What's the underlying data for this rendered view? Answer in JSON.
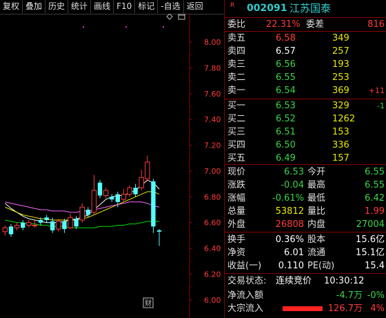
{
  "toolbar": [
    "复权",
    "叠加",
    "历史",
    "统计",
    "画线",
    "F10",
    "标记",
    "-自选",
    "返回"
  ],
  "stock": {
    "badge": "R",
    "code": "002091",
    "name": "江苏国泰"
  },
  "weibi": {
    "label": "委比",
    "value": "22.31%",
    "label2": "委差",
    "value2": "816"
  },
  "asks": [
    {
      "label": "卖五",
      "price": "6.58",
      "vol": "349",
      "chg": ""
    },
    {
      "label": "卖四",
      "price": "6.57",
      "vol": "257",
      "chg": ""
    },
    {
      "label": "卖三",
      "price": "6.56",
      "vol": "193",
      "chg": ""
    },
    {
      "label": "卖二",
      "price": "6.55",
      "vol": "253",
      "chg": ""
    },
    {
      "label": "卖一",
      "price": "6.54",
      "vol": "369",
      "chg": "+11"
    }
  ],
  "bids": [
    {
      "label": "买一",
      "price": "6.53",
      "vol": "329",
      "chg": "-1"
    },
    {
      "label": "买二",
      "price": "6.52",
      "vol": "1262",
      "chg": ""
    },
    {
      "label": "买三",
      "price": "6.51",
      "vol": "153",
      "chg": ""
    },
    {
      "label": "买四",
      "price": "6.50",
      "vol": "336",
      "chg": ""
    },
    {
      "label": "买五",
      "price": "6.49",
      "vol": "157",
      "chg": ""
    }
  ],
  "quote": [
    {
      "l1": "现价",
      "v1": "6.53",
      "l2": "今开",
      "v2": "6.55"
    },
    {
      "l1": "涨跌",
      "v1": "-0.04",
      "l2": "最高",
      "v2": "6.55"
    },
    {
      "l1": "涨幅",
      "v1": "-0.61%",
      "l2": "最低",
      "v2": "6.42"
    },
    {
      "l1": "总量",
      "v1": "53812",
      "l2": "量比",
      "v2": "1.99"
    },
    {
      "l1": "外盘",
      "v1": "26808",
      "l2": "内盘",
      "v2": "27004"
    }
  ],
  "fund": [
    {
      "l1": "换手",
      "v1": "0.36%",
      "l2": "股本",
      "v2": "15.6亿"
    },
    {
      "l1": "净资",
      "v1": "6.01",
      "l2": "流通",
      "v2": "15.1亿"
    },
    {
      "l1": "收益(一)",
      "v1": "0.110",
      "l2": "PE(动)",
      "v2": "15.4"
    }
  ],
  "status": {
    "label": "交易状态:",
    "value": "连续竞价",
    "time": "10:30:12"
  },
  "flow": [
    {
      "label": "净流入额",
      "value": "-4.7万",
      "pct": "-0%"
    },
    {
      "label": "大宗流入",
      "value": "126.7万",
      "pct": "4%"
    }
  ],
  "chart_data": {
    "type": "candlestick",
    "y_ticks": [
      "8.00",
      "7.80",
      "7.60",
      "7.40",
      "7.20",
      "7.00",
      "6.80",
      "6.60",
      "6.40",
      "6.20",
      "6.00"
    ],
    "ylim": [
      5.86,
      8.22
    ],
    "marker": "财",
    "candles": [
      {
        "o": 6.53,
        "c": 6.56,
        "h": 6.58,
        "l": 6.5
      },
      {
        "o": 6.57,
        "c": 6.51,
        "h": 6.59,
        "l": 6.49
      },
      {
        "o": 6.56,
        "c": 6.58,
        "h": 6.6,
        "l": 6.54
      },
      {
        "o": 6.6,
        "c": 6.56,
        "h": 6.62,
        "l": 6.54
      },
      {
        "o": 6.58,
        "c": 6.6,
        "h": 6.62,
        "l": 6.56
      },
      {
        "o": 6.58,
        "c": 6.58,
        "h": 6.62,
        "l": 6.56
      },
      {
        "o": 6.62,
        "c": 6.6,
        "h": 6.64,
        "l": 6.58
      },
      {
        "o": 6.64,
        "c": 6.62,
        "h": 6.66,
        "l": 6.6
      },
      {
        "o": 6.61,
        "c": 6.54,
        "h": 6.64,
        "l": 6.52
      },
      {
        "o": 6.55,
        "c": 6.61,
        "h": 6.63,
        "l": 6.53
      },
      {
        "o": 6.61,
        "c": 6.55,
        "h": 6.63,
        "l": 6.52
      },
      {
        "o": 6.56,
        "c": 6.64,
        "h": 6.67,
        "l": 6.55
      },
      {
        "o": 6.63,
        "c": 6.57,
        "h": 6.65,
        "l": 6.55
      },
      {
        "o": 6.62,
        "c": 6.72,
        "h": 6.75,
        "l": 6.6
      },
      {
        "o": 6.7,
        "c": 6.66,
        "h": 6.72,
        "l": 6.64
      },
      {
        "o": 6.68,
        "c": 6.85,
        "h": 6.97,
        "l": 6.66
      },
      {
        "o": 6.91,
        "c": 6.81,
        "h": 6.93,
        "l": 6.79
      },
      {
        "o": 6.81,
        "c": 6.85,
        "h": 6.87,
        "l": 6.79
      },
      {
        "o": 6.8,
        "c": 6.78,
        "h": 6.82,
        "l": 6.76
      },
      {
        "o": 6.82,
        "c": 6.76,
        "h": 6.84,
        "l": 6.72
      },
      {
        "o": 6.78,
        "c": 6.82,
        "h": 6.86,
        "l": 6.76
      },
      {
        "o": 6.82,
        "c": 6.87,
        "h": 6.89,
        "l": 6.8
      },
      {
        "o": 6.87,
        "c": 6.82,
        "h": 6.9,
        "l": 6.8
      },
      {
        "o": 6.87,
        "c": 6.95,
        "h": 7.01,
        "l": 6.85
      },
      {
        "o": 6.94,
        "c": 7.07,
        "h": 7.12,
        "l": 6.92
      },
      {
        "o": 6.92,
        "c": 6.57,
        "h": 6.94,
        "l": 6.52
      },
      {
        "o": 6.54,
        "c": 6.53,
        "h": 6.55,
        "l": 6.42
      }
    ],
    "ma_lines": [
      {
        "color": "#ffffff",
        "values": [
          6.75,
          6.71,
          6.68,
          6.65,
          6.63,
          6.62,
          6.61,
          6.6,
          6.6,
          6.6,
          6.61,
          6.62,
          6.63,
          6.64,
          6.66,
          6.7,
          6.74,
          6.78,
          6.8,
          6.81,
          6.81,
          6.83,
          6.85,
          6.89,
          6.93,
          6.91,
          6.86
        ]
      },
      {
        "color": "#e8e800",
        "values": [
          6.72,
          6.7,
          6.68,
          6.66,
          6.65,
          6.64,
          6.63,
          6.63,
          6.62,
          6.62,
          6.62,
          6.62,
          6.62,
          6.63,
          6.64,
          6.66,
          6.68,
          6.7,
          6.72,
          6.74,
          6.76,
          6.78,
          6.8,
          6.82,
          6.84,
          6.84,
          6.82
        ]
      },
      {
        "color": "#ff66ff",
        "values": [
          6.76,
          6.75,
          6.74,
          6.73,
          6.72,
          6.71,
          6.7,
          6.7,
          6.69,
          6.69,
          6.69,
          6.68,
          6.68,
          6.69,
          6.69,
          6.7,
          6.71,
          6.72,
          6.73,
          6.74,
          6.75,
          6.76,
          6.76,
          6.76,
          6.75,
          6.73,
          6.72
        ]
      },
      {
        "color": "#00dd00",
        "values": [
          6.62,
          6.61,
          6.6,
          6.6,
          6.59,
          6.59,
          6.58,
          6.58,
          6.57,
          6.57,
          6.57,
          6.56,
          6.56,
          6.56,
          6.56,
          6.56,
          6.57,
          6.57,
          6.57,
          6.58,
          6.58,
          6.59,
          6.59,
          6.6,
          6.61,
          6.61,
          6.61
        ]
      }
    ]
  }
}
